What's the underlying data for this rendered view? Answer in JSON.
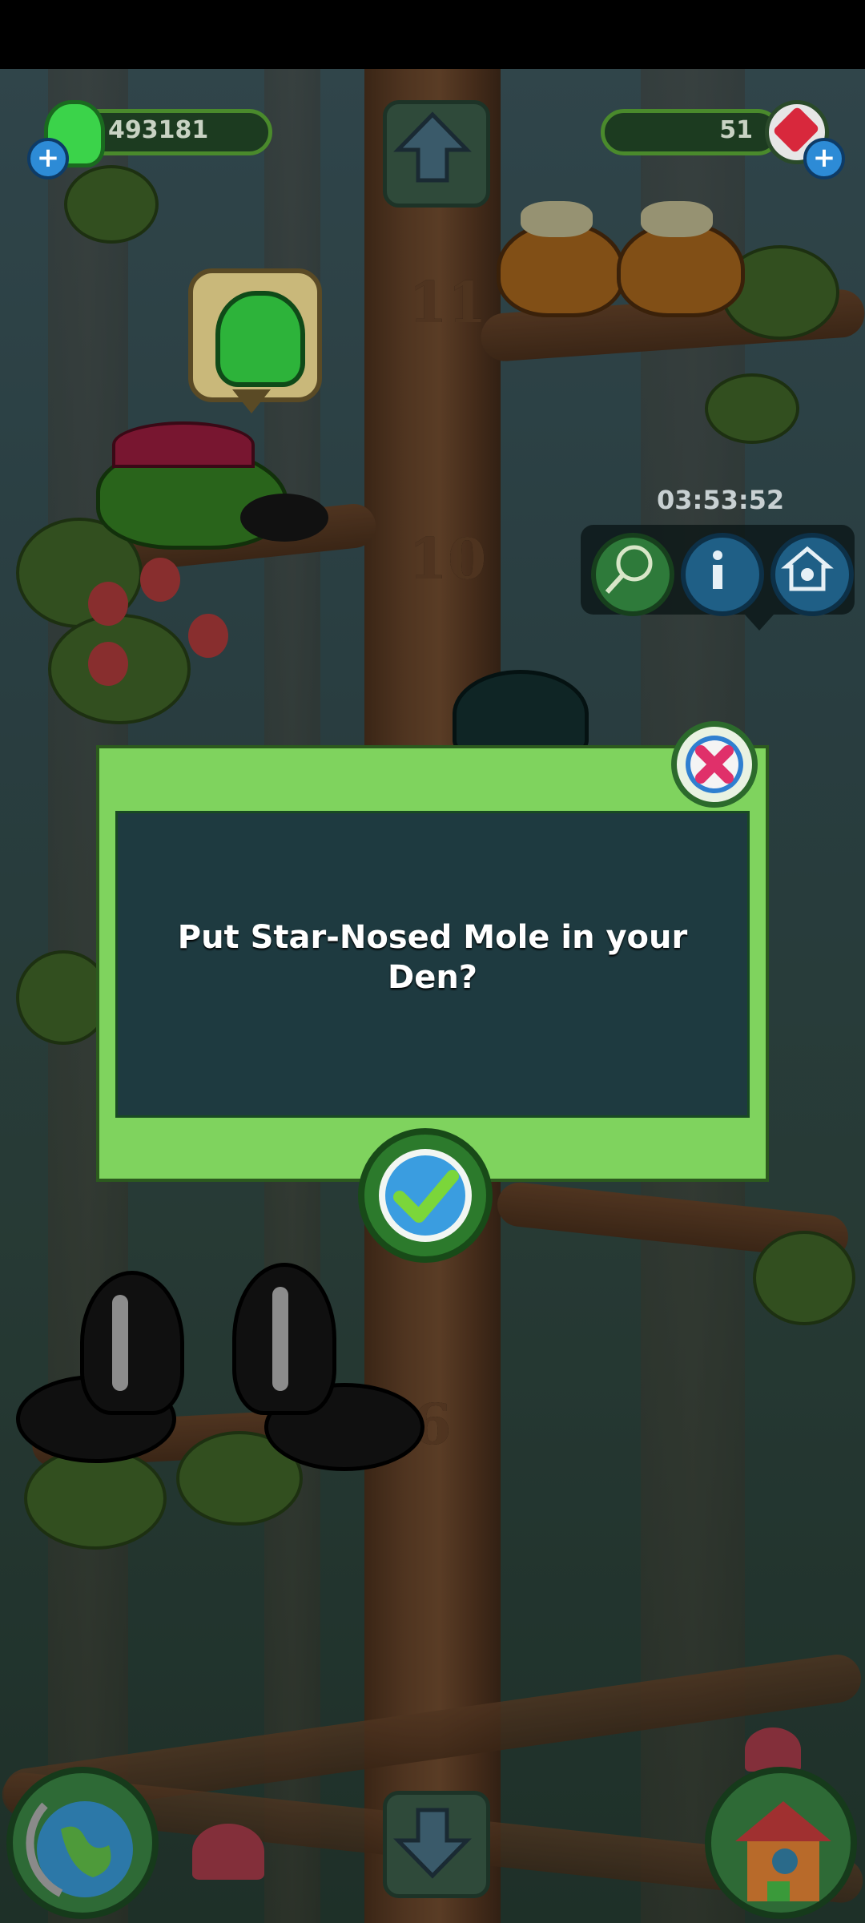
{
  "hud": {
    "gems_count": "493181",
    "crystals_count": "51"
  },
  "timer": {
    "value": "03:53:52"
  },
  "level_markers": [
    "11",
    "10",
    "6"
  ],
  "dialog": {
    "message": "Put Star-Nosed Mole in your Den?"
  },
  "icons": {
    "close": "close-x-icon",
    "confirm": "checkmark-icon",
    "net": "butterfly-net-icon",
    "info": "info-icon",
    "den": "den-house-icon",
    "up": "arrow-up-icon",
    "down": "arrow-down-icon",
    "globe": "globe-icon",
    "house": "treehouse-icon",
    "gem": "green-gem-icon",
    "crystal": "red-crystal-icon"
  },
  "colors": {
    "dialog_frame": "#7fd35e",
    "dialog_panel": "#1e3a40",
    "close_accent": "#e0306a",
    "confirm_accent": "#3a9de0"
  }
}
